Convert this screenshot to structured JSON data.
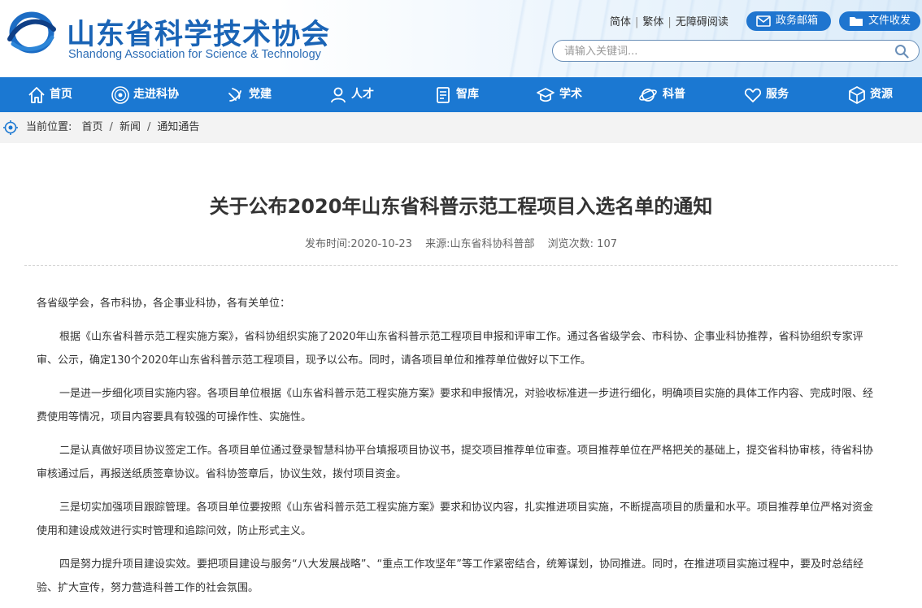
{
  "site": {
    "title": "山东省科学技术协会",
    "subtitle": "Shandong Association for Science & Technology"
  },
  "toplinks": {
    "simplified": "简体",
    "traditional": "繁体",
    "accessible": "无障碍阅读",
    "separator": "|"
  },
  "buttons": {
    "gov_mail": "政务邮箱",
    "doc_exchange": "文件收发"
  },
  "search": {
    "placeholder": "请输入关键词..."
  },
  "nav": {
    "items": [
      {
        "label": "首页",
        "icon": "home-icon"
      },
      {
        "label": "走进科协",
        "icon": "emblem-icon"
      },
      {
        "label": "党建",
        "icon": "party-icon"
      },
      {
        "label": "人才",
        "icon": "person-icon"
      },
      {
        "label": "智库",
        "icon": "book-icon"
      },
      {
        "label": "学术",
        "icon": "graduation-cap-icon"
      },
      {
        "label": "科普",
        "icon": "planet-icon"
      },
      {
        "label": "服务",
        "icon": "heart-hand-icon"
      },
      {
        "label": "资源",
        "icon": "cube-icon"
      }
    ]
  },
  "breadcrumb": {
    "prefix": "当前位置:",
    "items": [
      "首页",
      "新闻",
      "通知通告"
    ],
    "separator": "/"
  },
  "article": {
    "title": "关于公布2020年山东省科普示范工程项目入选名单的通知",
    "date_label": "发布时间:",
    "date": "2020-10-23",
    "source_label": "来源:",
    "source": "山东省科协科普部",
    "views_label": "浏览次数:",
    "views": "107",
    "paragraphs": [
      "各省级学会，各市科协，各企事业科协，各有关单位：",
      "根据《山东省科普示范工程实施方案》，省科协组织实施了2020年山东省科普示范工程项目申报和评审工作。通过各省级学会、市科协、企事业科协推荐，省科协组织专家评审、公示，确定130个2020年山东省科普示范工程项目，现予以公布。同时，请各项目单位和推荐单位做好以下工作。",
      "一是进一步细化项目实施内容。各项目单位根据《山东省科普示范工程实施方案》要求和申报情况，对验收标准进一步进行细化，明确项目实施的具体工作内容、完成时限、经费使用等情况，项目内容要具有较强的可操作性、实施性。",
      "二是认真做好项目协议签定工作。各项目单位通过登录智慧科协平台填报项目协议书，提交项目推荐单位审查。项目推荐单位在严格把关的基础上，提交省科协审核，待省科协审核通过后，再报送纸质签章协议。省科协签章后，协议生效，拨付项目资金。",
      "三是切实加强项目跟踪管理。各项目单位要按照《山东省科普示范工程实施方案》要求和协议内容，扎实推进项目实施，不断提高项目的质量和水平。项目推荐单位严格对资金使用和建设成效进行实时管理和追踪问效，防止形式主义。",
      "四是努力提升项目建设实效。要把项目建设与服务“八大发展战略”、“重点工作攻坚年”等工作紧密结合，统筹谋划，协同推进。同时，在推进项目实施过程中，要及时总结经验、扩大宣传，努力营造科普工作的社会氛围。"
    ]
  }
}
